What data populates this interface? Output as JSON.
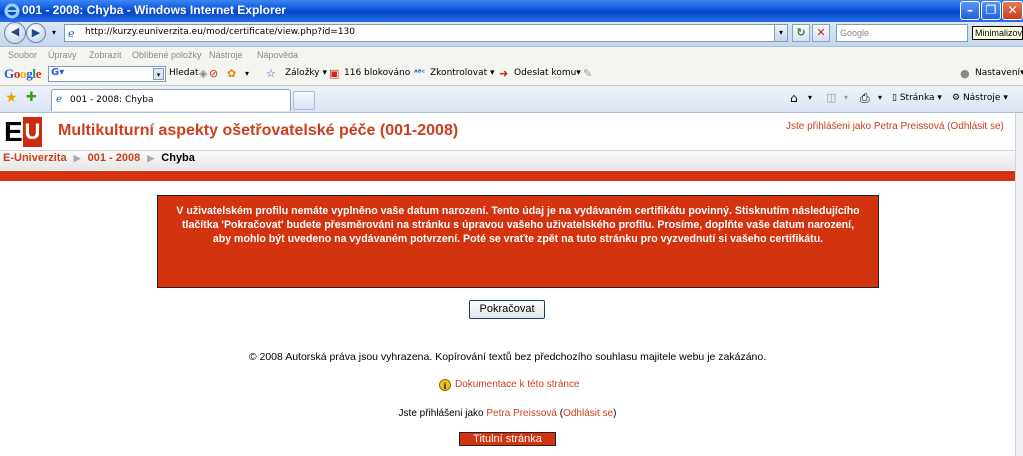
{
  "window": {
    "title": "001 - 2008: Chyba - Windows Internet Explorer",
    "tooltip": "Minimalizovat"
  },
  "address_bar": {
    "url": "http://kurzy.euniverzita.eu/mod/certificate/view.php?id=130",
    "search_placeholder": "Google"
  },
  "menu": {
    "items": [
      "Soubor",
      "Úpravy",
      "Zobrazit",
      "Oblíbené položky",
      "Nástroje",
      "Nápověda"
    ]
  },
  "google_toolbar": {
    "logo": "Google",
    "search_label": "Hledat",
    "bookmarks": "Záložky",
    "blocked": "116 blokováno",
    "check": "Zkontrolovat",
    "send_to": "Odeslat komu",
    "settings": "Nastavení"
  },
  "tabs": {
    "active_label": "001 - 2008: Chyba",
    "page_menu": "Stránka",
    "tools_menu": "Nástroje"
  },
  "page": {
    "logo": {
      "e": "E",
      "u": "U"
    },
    "course_title": "Multikulturní aspekty ošetřovatelské péče (001-2008)",
    "login_info": "Jste přihlášeni jako Petra Preissová (Odhlásit se)",
    "breadcrumb": {
      "home": "E-Univerzita",
      "course": "001 - 2008",
      "current": "Chyba"
    },
    "error_message": "V uživatelském profilu nemáte vyplněno vaše datum narození. Tento údaj je na vydávaném certifikátu povinný. Stisknutím následujícího tlačítka 'Pokračovat' budete přesměrováni na stránku s úpravou vašeho uživatelského profilu. Prosíme, doplňte vaše datum narození, aby mohlo být uvedeno na vydávaném potvrzení. Poté se vraťte zpět na tuto stránku pro vyzvednutí si vašeho certifikátu.",
    "continue_button": "Pokračovat",
    "copyright": "© 2008 Autorská práva jsou vyhrazena. Kopírování textů bez předchozího souhlasu majitele webu je zakázáno.",
    "docs_link": "Dokumentace k této stránce",
    "footer_prefix": "Jste přihlášeni jako",
    "footer_user": "Petra Preissová",
    "footer_logout": "Odhlásit se",
    "home_button": "Titulní stránka"
  }
}
